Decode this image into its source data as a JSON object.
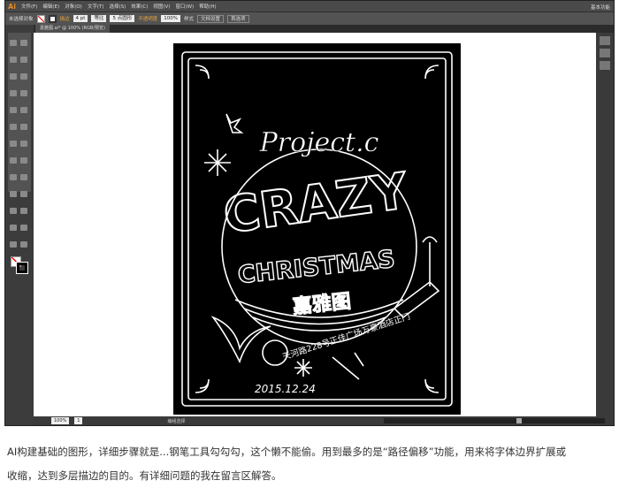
{
  "app": {
    "logo": "Ai",
    "menu": [
      "文件(F)",
      "编辑(E)",
      "对象(O)",
      "文字(T)",
      "选择(S)",
      "效果(C)",
      "视图(V)",
      "窗口(W)",
      "帮助(H)"
    ],
    "workspace": "基本功能"
  },
  "control": {
    "selection": "未选择对象",
    "stroke_label": "描边",
    "stroke_weight": "4 pt",
    "profile": "等比",
    "brush": "5 点圆形",
    "opacity_label": "不透明度",
    "opacity": "100%",
    "style_label": "样式",
    "doc_setup": "文档设置",
    "prefs": "首选项"
  },
  "tab": "嘉雅图.ai* @ 100% (RGB/预览)",
  "status": {
    "zoom": "100%",
    "artboard": "1",
    "tool": "编组选择"
  },
  "artwork": {
    "script": "Project.c",
    "title1": "CRAZY",
    "title2": "CHRISTMAS",
    "brand": "嘉雅图",
    "address": "天河路228号正佳广场万豪酒店正门",
    "date": "2015.12.24"
  },
  "caption": {
    "line1": "AI构建基础的图形，详细步骤就是...钢笔工具勾勾勾，这个懒不能偷。用到最多的是“路径偏移”功能，用来将字体边界扩展或",
    "line2": "收缩，达到多层描边的目的。有详细问题的我在留言区解答。"
  }
}
